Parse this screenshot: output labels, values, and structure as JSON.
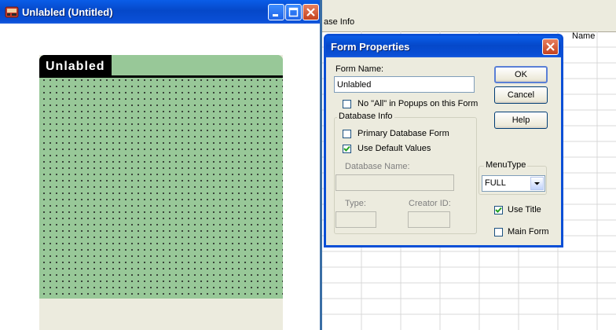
{
  "left_window": {
    "title": "Unlabled (Untitled)",
    "form_title": "Unlabled"
  },
  "background_window": {
    "header_text": "ase Info",
    "column_header": "Name"
  },
  "dialog": {
    "title": "Form Properties",
    "form_name_label": "Form Name:",
    "form_name_value": "Unlabled",
    "no_all_label": "No \"All\" in Popups on this Form",
    "no_all_checked": false,
    "database_group_label": "Database Info",
    "primary_db_label": "Primary Database Form",
    "primary_db_checked": false,
    "use_default_label": "Use Default Values",
    "use_default_checked": true,
    "db_name_label": "Database Name:",
    "type_label": "Type:",
    "creator_label": "Creator ID:",
    "menutype_label": "MenuType",
    "menutype_value": "FULL",
    "use_title_label": "Use Title",
    "use_title_checked": true,
    "main_form_label": "Main Form",
    "main_form_checked": false,
    "ok_label": "OK",
    "cancel_label": "Cancel",
    "help_label": "Help"
  },
  "colors": {
    "titlebar_blue": "#0a4fd6",
    "form_green": "#98c898",
    "dialog_bg": "#ecebde"
  }
}
